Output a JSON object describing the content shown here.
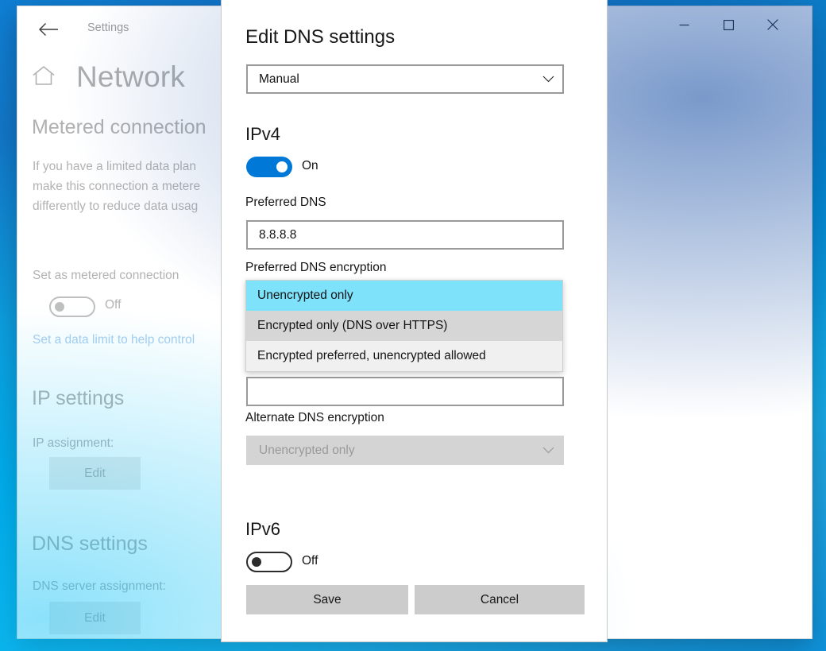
{
  "window": {
    "app_label": "Settings",
    "back_icon": "back-arrow-icon",
    "minimize_label": "—",
    "maximize_label": "□",
    "close_label": "✕"
  },
  "settings_page": {
    "home_icon": "home-icon",
    "title": "Network",
    "metered": {
      "heading": "Metered connection",
      "description": "If you have a limited data plan\nmake this connection a metere\ndifferently to reduce data usag",
      "toggle_label": "Set as metered connection",
      "toggle_state": "Off",
      "link": "Set a data limit to help control"
    },
    "ip_settings": {
      "heading": "IP settings",
      "assignment_label": "IP assignment:",
      "edit_button": "Edit"
    },
    "dns_settings": {
      "heading": "DNS settings",
      "assignment_label": "DNS server assignment:",
      "edit_button": "Edit"
    }
  },
  "dialog": {
    "title": "Edit DNS settings",
    "mode_dropdown": {
      "value": "Manual",
      "chevron_icon": "chevron-down-icon"
    },
    "ipv4": {
      "heading": "IPv4",
      "toggle_state": "On",
      "preferred_dns_label": "Preferred DNS",
      "preferred_dns_value": "8.8.8.8",
      "preferred_encryption_label": "Preferred DNS encryption",
      "preferred_encryption_options": [
        "Unencrypted only",
        "Encrypted only (DNS over HTTPS)",
        "Encrypted preferred, unencrypted allowed"
      ],
      "preferred_encryption_selected": "Unencrypted only",
      "preferred_encryption_hovered": "Encrypted only (DNS over HTTPS)",
      "alternate_dns_value": "",
      "alternate_encryption_label": "Alternate DNS encryption",
      "alternate_encryption_value": "Unencrypted only"
    },
    "ipv6": {
      "heading": "IPv6",
      "toggle_state": "Off"
    },
    "save_button": "Save",
    "cancel_button": "Cancel"
  },
  "colors": {
    "accent": "#0078D7",
    "selection_highlight": "#7FE2FB",
    "hover": "#D6D6D6",
    "listbox_bg": "#F0F0F0",
    "button_bg": "#CCCCCC",
    "disabled_text": "#B2B2B2"
  }
}
